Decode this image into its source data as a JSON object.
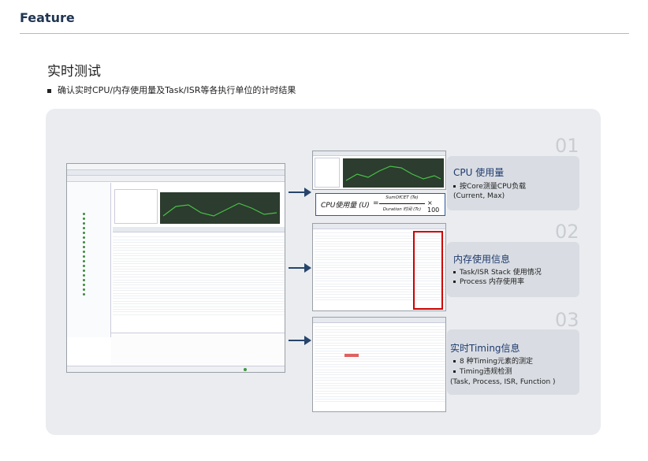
{
  "header": {
    "title": "Feature"
  },
  "section": {
    "title": "实时测试",
    "bullet": "确认实时CPU/内存使用量及Task/ISR等各执行单位的计时结果"
  },
  "numbers": [
    "01",
    "02",
    "03"
  ],
  "cards": [
    {
      "title": "CPU 使用量",
      "items": [
        "按Core测量CPU负载",
        "(Current, Max)"
      ]
    },
    {
      "title": "内存使用信息",
      "items": [
        "Task/ISR Stack 使用情况",
        "Process 内存使用率"
      ]
    },
    {
      "title": "实时Timing信息",
      "items": [
        "8 种Timing元素的测定",
        "Timing违规检测",
        "(Task, Process, ISR, Function )"
      ]
    }
  ],
  "formula": {
    "lhs": "CPU使用量 (U)",
    "eq": "=",
    "numerator": "SumOfCET (Te)",
    "denominator": "Duration 时间 (Tc)",
    "factor": "× 100"
  },
  "colors": {
    "accent": "#1f3552",
    "panel": "#eaecef",
    "card": "#d9dde3",
    "arrow": "#27456b",
    "highlight": "#d00000",
    "graph_bg": "#2c3c2e",
    "graph_line": "#48c048"
  }
}
